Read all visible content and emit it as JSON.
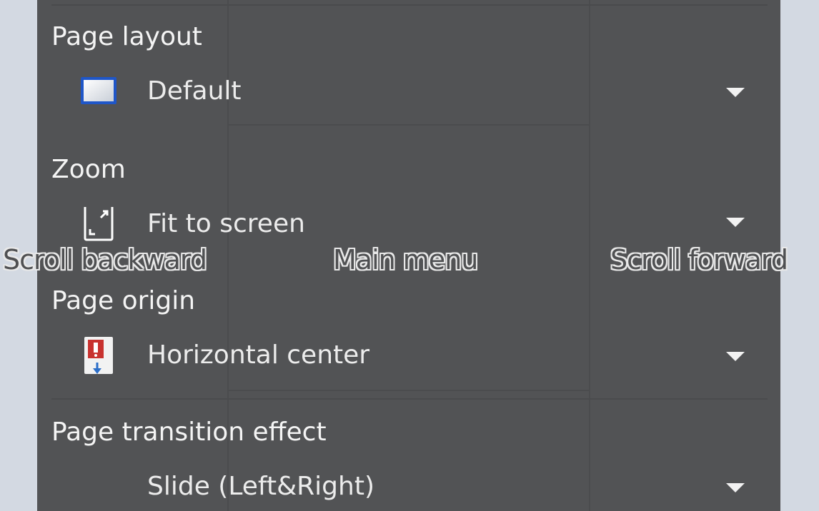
{
  "settings": {
    "page_layout": {
      "title": "Page layout",
      "value": "Default",
      "icon": "page-layout-default-icon"
    },
    "zoom": {
      "title": "Zoom",
      "value": "Fit to screen",
      "icon": "fit-to-screen-icon"
    },
    "page_origin": {
      "title": "Page origin",
      "value": "Horizontal center",
      "icon": "horizontal-center-icon"
    },
    "page_transition": {
      "title": "Page transition effect",
      "value": "Slide (Left&Right)"
    }
  },
  "overlay": {
    "scroll_backward": "Scroll backward",
    "main_menu": "Main menu",
    "scroll_forward": "Scroll forward"
  },
  "colors": {
    "background": "#d3d9e2",
    "panel": "#525355",
    "text": "#f4f4f4",
    "icon_blue": "#1f56c8",
    "icon_red": "#c8322f"
  }
}
